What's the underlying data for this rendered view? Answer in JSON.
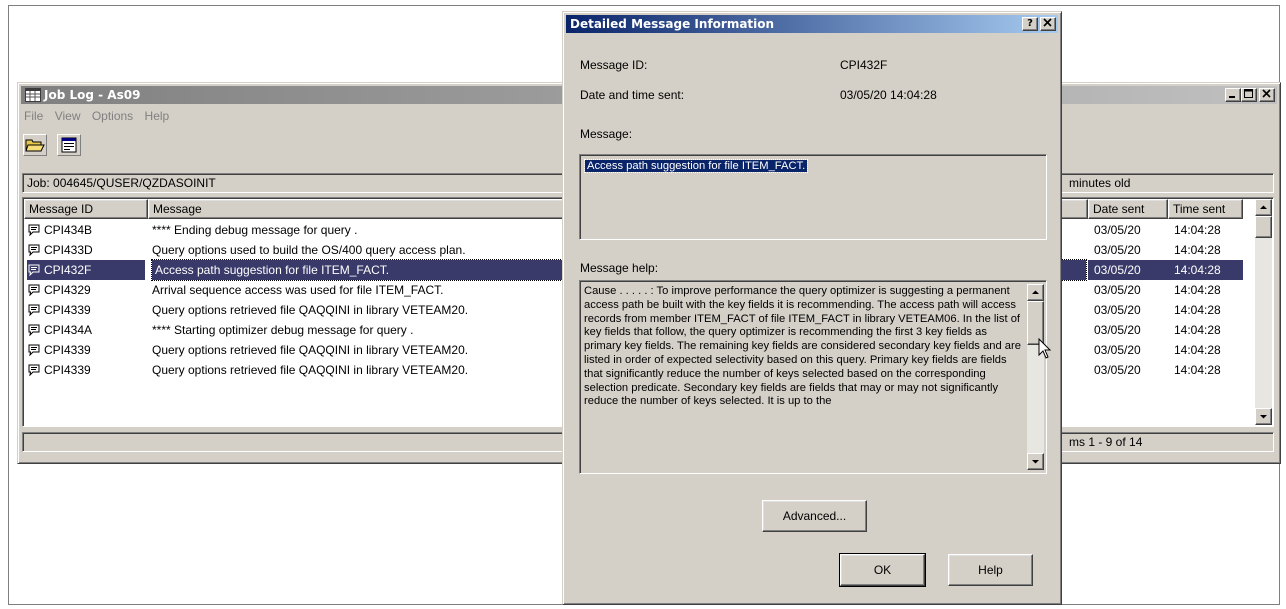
{
  "joblog": {
    "title": "Job Log - As09",
    "menu": [
      "File",
      "View",
      "Options",
      "Help"
    ],
    "job_label": "Job:  004645/QUSER/QZDASOINIT",
    "age_text": "minutes old",
    "columns": [
      "Message ID",
      "Message",
      "Date sent",
      "Time sent"
    ],
    "rows": [
      {
        "id": "CPI434B",
        "message": "**** Ending debug message for query .",
        "date": "03/05/20",
        "time": "14:04:28"
      },
      {
        "id": "CPI433D",
        "message": "Query options used to build the OS/400 query access plan.",
        "date": "03/05/20",
        "time": "14:04:28"
      },
      {
        "id": "CPI432F",
        "message": "Access path suggestion for file ITEM_FACT.",
        "date": "03/05/20",
        "time": "14:04:28"
      },
      {
        "id": "CPI4329",
        "message": "Arrival sequence access was used for file ITEM_FACT.",
        "date": "03/05/20",
        "time": "14:04:28"
      },
      {
        "id": "CPI4339",
        "message": "Query options retrieved file QAQQINI in library VETEAM20.",
        "date": "03/05/20",
        "time": "14:04:28"
      },
      {
        "id": "CPI434A",
        "message": "**** Starting optimizer debug message for query .",
        "date": "03/05/20",
        "time": "14:04:28"
      },
      {
        "id": "CPI4339",
        "message": "Query options retrieved file QAQQINI in library VETEAM20.",
        "date": "03/05/20",
        "time": "14:04:28"
      },
      {
        "id": "CPI4339",
        "message": "Query options retrieved file QAQQINI in library VETEAM20.",
        "date": "03/05/20",
        "time": "14:04:28"
      }
    ],
    "selected_index": 2,
    "status_text": "ms 1 - 9 of 14"
  },
  "dialog": {
    "title": "Detailed Message Information",
    "help_btn": "?",
    "close_btn": "×",
    "message_id_label": "Message ID:",
    "message_id_value": "CPI432F",
    "date_label": "Date and time sent:",
    "date_value": "03/05/20 14:04:28",
    "message_label": "Message:",
    "message_text": "Access path suggestion for file ITEM_FACT.",
    "help_label": "Message help:",
    "help_text": "Cause . . . . . :   To improve performance the query optimizer is suggesting a permanent access path be built with the key fields it is recommending. The access path will access records from member ITEM_FACT of file ITEM_FACT in library VETEAM06. In the list of key fields that follow, the query optimizer is recommending the first 3 key fields as primary key fields. The remaining key fields are considered secondary key fields and are listed in order of expected selectivity based on this query. Primary key fields are fields that significantly reduce the number of keys selected based on the corresponding selection predicate. Secondary key fields are fields that may or may not significantly reduce the number of keys selected. It is up to the",
    "advanced_button": "Advanced...",
    "ok_button": "OK",
    "help_button": "Help"
  },
  "colors": {
    "active_title": "#0a246a",
    "inactive_title": "#808080",
    "selection": "#3a3a6a",
    "face": "#d4d0c8"
  }
}
